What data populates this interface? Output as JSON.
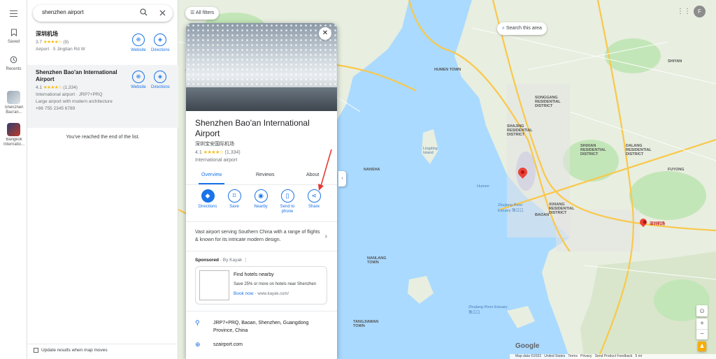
{
  "rail": {
    "saved_label": "Saved",
    "recents_label": "Recents",
    "recent_items": [
      {
        "label": "Shenzhen Bao'an..."
      },
      {
        "label": "Bangkok Internatio..."
      }
    ]
  },
  "search": {
    "value": "shenzhen airport"
  },
  "results": [
    {
      "title": "深圳机场",
      "rating": "3.7",
      "stars": "★★★★☆",
      "count": "(9)",
      "lines": [
        "Airport · 5 Jingtian Rd W"
      ],
      "website_label": "Website",
      "directions_label": "Directions"
    },
    {
      "title": "Shenzhen Bao'an International Airport",
      "rating": "4.1",
      "stars": "★★★★☆",
      "count": "(1,334)",
      "lines": [
        "International airport · JRP7+PRQ",
        "Large airport with modern architecture",
        "+86 755 2345 6789"
      ],
      "website_label": "Website",
      "directions_label": "Directions"
    }
  ],
  "end_of_list": "You've reached the end of the list.",
  "update_when_moves": "Update results when map moves",
  "map": {
    "all_filters": "All filters",
    "search_this_area": "Search this area",
    "account_initial": "F",
    "google_logo": "Google",
    "footer": [
      "Map data ©2023",
      "United States",
      "Terms",
      "Privacy",
      "Send Product Feedback",
      "5 mi"
    ],
    "labels": {
      "humen": "HUMEN TOWN",
      "songgang": "SONGGANG RESIDENTIAL DISTRICT",
      "shajing": "SHAJING RESIDENTIAL DISTRICT",
      "shixian": "SHIXIAN RESIDENTIAL DISTRICT",
      "dalang": "DALANG RESIDENTIAL DISTRICT",
      "bao_an": "BAOAN",
      "xixiang": "XIXIANG RESIDENTIAL DISTRICT",
      "nansha": "NANSHA",
      "lingding": "Lingding Island",
      "humen_bridge": "Humen",
      "zhujiang_estuary": "Zhujiang River Estuary 珠江口",
      "zhujiang_estuary2": "Zhujiang River Estuary 珠江口",
      "nanlang": "NANLANG TOWN",
      "tangjiawan": "TANGJIAWAN TOWN",
      "shenzhen_airport": "深圳机场",
      "fuyong": "FUYONG",
      "shiyan": "SHIYAN"
    }
  },
  "place": {
    "name": "Shenzhen Bao'an International Airport",
    "name_cn": "深圳宝安国际机场",
    "rating": "4.1",
    "stars": "★★★★☆",
    "count": "(1,334)",
    "category": "International airport",
    "tabs": [
      "Overview",
      "Reviews",
      "About"
    ],
    "actions": [
      "Directions",
      "Save",
      "Nearby",
      "Send to phone",
      "Share"
    ],
    "description": "Vast airport serving Southern China with a range of flights & known for its intricate modern design.",
    "sponsored_label": "Sponsored",
    "sponsored_by": "By Kayak",
    "ad": {
      "title": "Find hotels nearby",
      "text": "Save 25% or more on hotels near Shenzhen",
      "link": "Book now",
      "url": "www.kayak.com/"
    },
    "address": "JRP7+PRQ, Baoan, Shenzhen, Guangdong Province, China",
    "website": "szairport.com"
  },
  "colors": {
    "accent": "#1a73e8",
    "water": "#aadaff",
    "land": "#e8eee0",
    "park": "#c3e6b8",
    "pin": "#ea4335",
    "annotation": "#e53935"
  }
}
